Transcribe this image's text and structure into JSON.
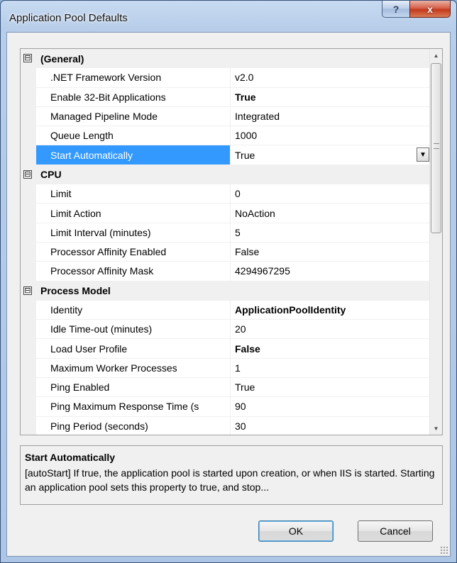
{
  "window": {
    "title": "Application Pool Defaults",
    "help_label": "?",
    "close_label": "x"
  },
  "property_grid": {
    "collapse_glyph": "⊟",
    "categories": [
      {
        "name": "(General)",
        "properties": [
          {
            "name": ".NET Framework Version",
            "value": "v2.0",
            "bold": false
          },
          {
            "name": "Enable 32-Bit Applications",
            "value": "True",
            "bold": true
          },
          {
            "name": "Managed Pipeline Mode",
            "value": "Integrated",
            "bold": false
          },
          {
            "name": "Queue Length",
            "value": "1000",
            "bold": false
          },
          {
            "name": "Start Automatically",
            "value": "True",
            "bold": false,
            "selected": true
          }
        ]
      },
      {
        "name": "CPU",
        "properties": [
          {
            "name": "Limit",
            "value": "0",
            "bold": false
          },
          {
            "name": "Limit Action",
            "value": "NoAction",
            "bold": false
          },
          {
            "name": "Limit Interval (minutes)",
            "value": "5",
            "bold": false
          },
          {
            "name": "Processor Affinity Enabled",
            "value": "False",
            "bold": false
          },
          {
            "name": "Processor Affinity Mask",
            "value": "4294967295",
            "bold": false
          }
        ]
      },
      {
        "name": "Process Model",
        "properties": [
          {
            "name": "Identity",
            "value": "ApplicationPoolIdentity",
            "bold": true
          },
          {
            "name": "Idle Time-out (minutes)",
            "value": "20",
            "bold": false
          },
          {
            "name": "Load User Profile",
            "value": "False",
            "bold": true
          },
          {
            "name": "Maximum Worker Processes",
            "value": "1",
            "bold": false
          },
          {
            "name": "Ping Enabled",
            "value": "True",
            "bold": false
          },
          {
            "name": "Ping Maximum Response Time (s",
            "value": "90",
            "bold": false
          },
          {
            "name": "Ping Period (seconds)",
            "value": "30",
            "bold": false
          }
        ]
      }
    ]
  },
  "description": {
    "title": "Start Automatically",
    "text": "[autoStart] If true, the application pool is started upon creation, or when IIS is started.  Starting an application pool sets this property to true, and stop..."
  },
  "buttons": {
    "ok_label": "OK",
    "cancel_label": "Cancel"
  },
  "colors": {
    "selection": "#3399ff",
    "category_bg": "#f0f0f0"
  }
}
